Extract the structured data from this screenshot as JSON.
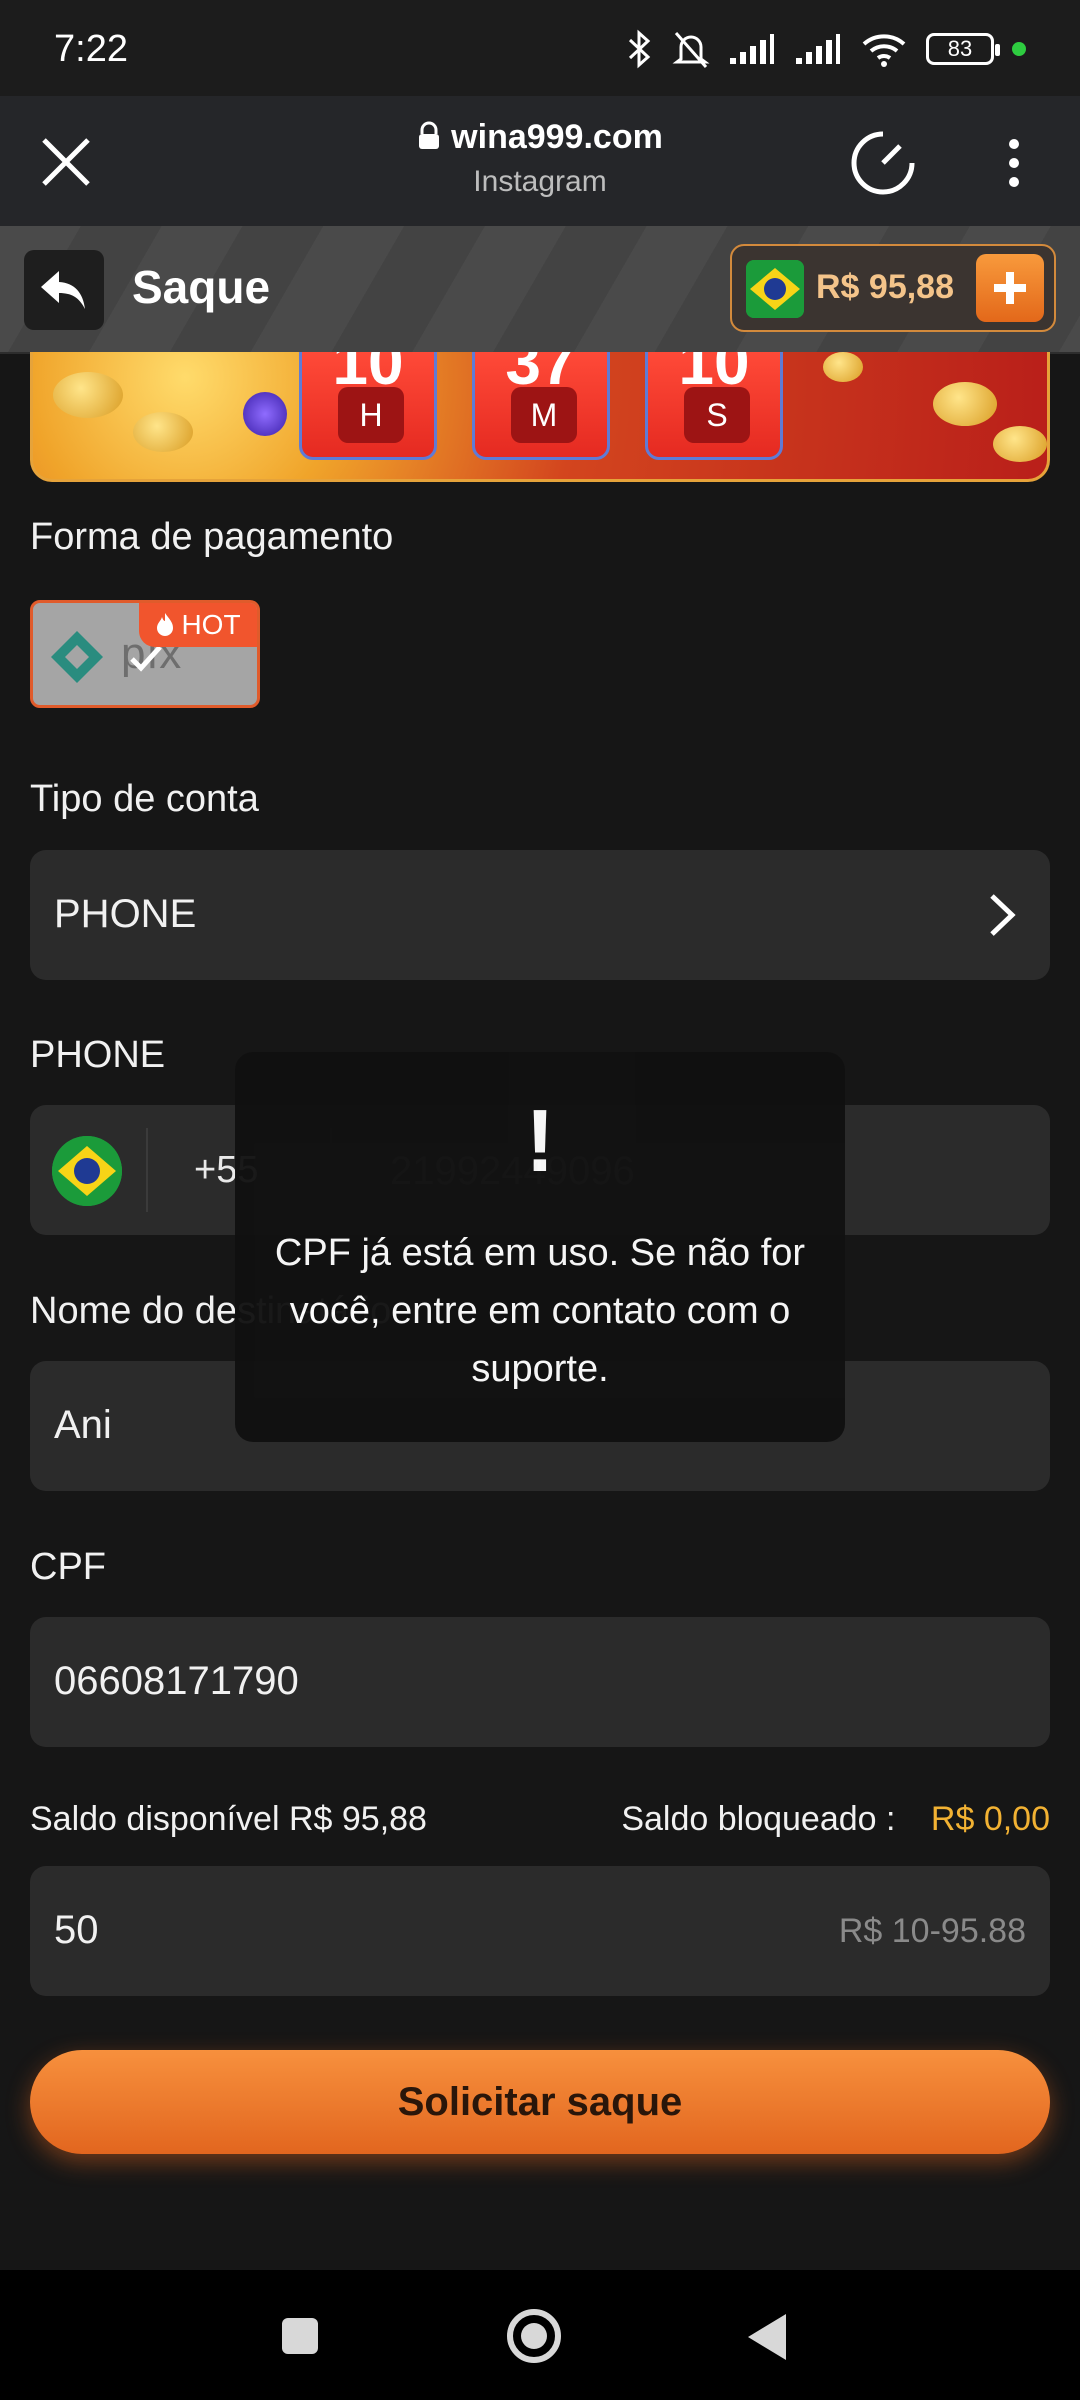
{
  "status_bar": {
    "time": "7:22",
    "battery": "83"
  },
  "browser": {
    "url": "wina999.com",
    "source": "Instagram"
  },
  "header": {
    "title": "Saque",
    "balance": "R$ 95,88"
  },
  "banner": {
    "timers": [
      {
        "value": "10",
        "unit": "H"
      },
      {
        "value": "37",
        "unit": "M"
      },
      {
        "value": "10",
        "unit": "S"
      }
    ]
  },
  "payment": {
    "label": "Forma de pagamento",
    "badge": "HOT",
    "method_text": "pix"
  },
  "account_type": {
    "label": "Tipo de conta",
    "value": "PHONE"
  },
  "phone": {
    "label": "PHONE",
    "country_code": "+55",
    "number": "21992449096"
  },
  "recipient": {
    "label": "Nome do destinatário",
    "value": "Ani"
  },
  "cpf": {
    "label": "CPF",
    "value": "06608171790"
  },
  "balances": {
    "available_label": "Saldo disponível",
    "available_value": "R$ 95,88",
    "blocked_label": "Saldo bloqueado :",
    "blocked_value": "R$ 0,00"
  },
  "amount": {
    "value": "50",
    "range_hint": "R$ 10-95.88"
  },
  "submit_label": "Solicitar saque",
  "toast": {
    "icon": "!",
    "message": "CPF já está em uso. Se não for você, entre em contato com o suporte."
  },
  "colors": {
    "accent": "#e2661f",
    "gold": "#f2b233",
    "field_bg": "#2b2b2b",
    "page_bg": "#161616"
  }
}
